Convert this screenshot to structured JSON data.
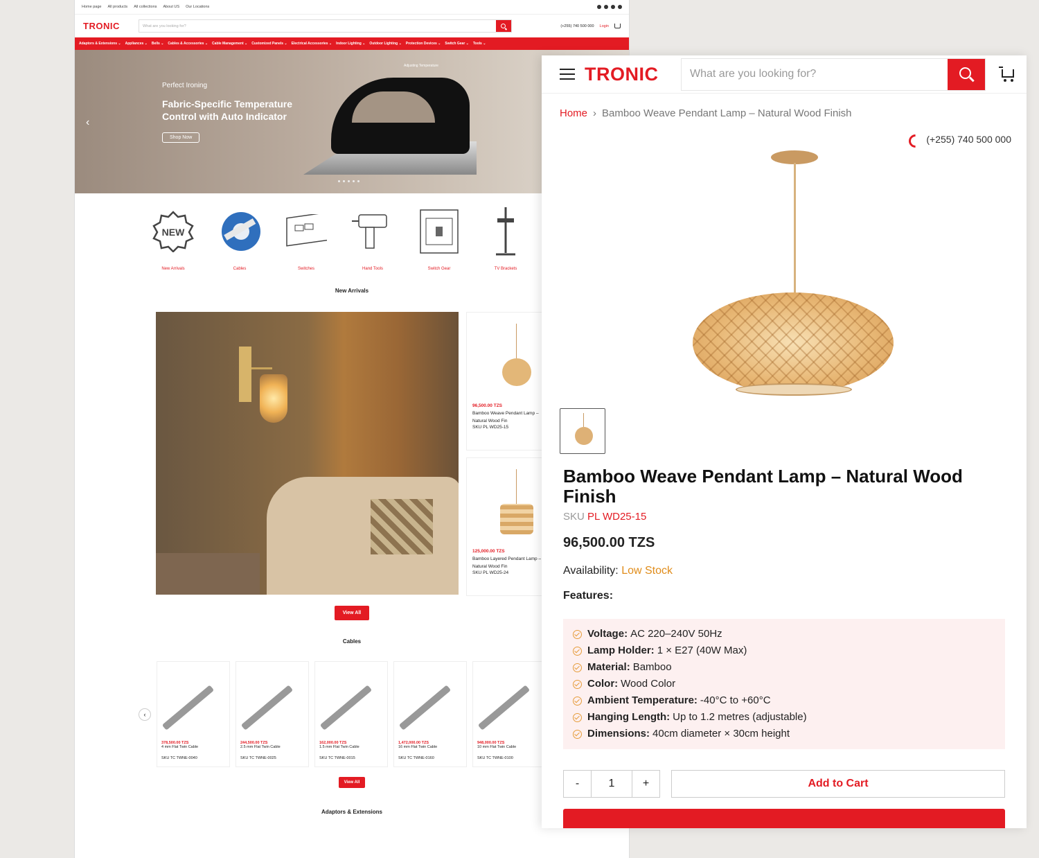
{
  "brand": "TRONIC",
  "colors": {
    "accent": "#e31b23",
    "low_stock": "#e08c1a",
    "feature_bg": "#fdf0f0"
  },
  "desktop": {
    "topbar_links": [
      "Home page",
      "All products",
      "All collections",
      "About US",
      "Our Locations"
    ],
    "search_placeholder": "What are you looking for?",
    "phone": "(+255) 740 500 000",
    "login": "Login",
    "nav": [
      "Adaptors & Extensions ⌄",
      "Appliances ⌄",
      "Bells ⌄",
      "Cables & Accessories ⌄",
      "Cable Management ⌄",
      "Customized Panels ⌄",
      "Electrical Accessories ⌄",
      "Indoor Lighting ⌄",
      "Outdoor Lighting ⌄",
      "Protection Devices ⌄",
      "Switch Gear ⌄",
      "Tools ⌄"
    ],
    "hero": {
      "eyebrow": "Perfect Ironing",
      "headline": "Fabric-Specific Temperature Control with Auto Indicator",
      "cta": "Shop Now",
      "product_label": "Adjusting Temperature"
    },
    "categories": [
      "New Arrivals",
      "Cables",
      "Switches",
      "Hand Tools",
      "Switch Gear",
      "TV Brackets"
    ],
    "new_arrivals_title": "New Arrivals",
    "new_arrivals": [
      {
        "price": "96,500.00 TZS",
        "name": "Bamboo Weave Pendant Lamp – Natural Wood Fin",
        "sku": "SKU PL WD25-15"
      },
      {
        "price": "125,000.00 TZS",
        "name": "Bamboo Layered Pendant Lamp – Natural Wood Fin",
        "sku": "SKU PL WD25-24"
      }
    ],
    "view_all": "View All",
    "cables_title": "Cables",
    "cables": [
      {
        "price": "378,500.00 TZS",
        "name": "4 mm Flat Twin Cable",
        "sku": "SKU TC TWNE-0040"
      },
      {
        "price": "244,500.00 TZS",
        "name": "2.5 mm Flat Twin Cable",
        "sku": "SKU TC TWNE-0025"
      },
      {
        "price": "162,000.00 TZS",
        "name": "1.5 mm Flat Twin Cable",
        "sku": "SKU TC TWNE-0015"
      },
      {
        "price": "1,472,000.00 TZS",
        "name": "16 mm Flat Twin Cable",
        "sku": "SKU TC TWNE-0160"
      },
      {
        "price": "948,000.00 TZS",
        "name": "10 mm Flat Twin Cable",
        "sku": "SKU TC TWNE-0100"
      }
    ],
    "adaptors_title": "Adaptors & Extensions"
  },
  "mobile": {
    "search_placeholder": "What are you looking for?",
    "breadcrumb": {
      "home": "Home",
      "separator": "›",
      "current": "Bamboo Weave Pendant Lamp – Natural Wood Finish"
    },
    "phone": "(+255) 740 500 000",
    "product": {
      "title": "Bamboo Weave Pendant Lamp – Natural Wood Finish",
      "sku_label": "SKU",
      "sku": "PL WD25-15",
      "price": "96,500.00 TZS",
      "availability_label": "Availability:",
      "availability": "Low Stock",
      "features_label": "Features:",
      "features": [
        {
          "label": "Voltage:",
          "value": "AC 220–240V 50Hz"
        },
        {
          "label": "Lamp Holder:",
          "value": "1 × E27 (40W Max)"
        },
        {
          "label": "Material:",
          "value": "Bamboo"
        },
        {
          "label": "Color:",
          "value": "Wood Color"
        },
        {
          "label": "Ambient Temperature:",
          "value": "-40°C to +60°C"
        },
        {
          "label": "Hanging Length:",
          "value": "Up to 1.2 metres (adjustable)"
        },
        {
          "label": "Dimensions:",
          "value": "40cm diameter × 30cm height"
        }
      ],
      "qty_minus": "-",
      "qty": "1",
      "qty_plus": "+",
      "add_to_cart": "Add to Cart"
    }
  }
}
